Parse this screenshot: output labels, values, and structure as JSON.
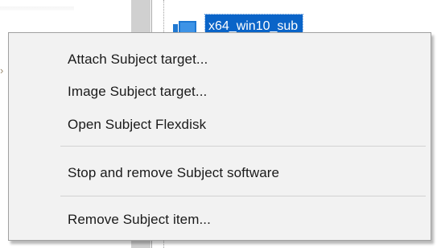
{
  "background": {
    "tree_node": {
      "label": "x64_win10_sub"
    }
  },
  "context_menu": {
    "items": [
      {
        "label": "Attach Subject target..."
      },
      {
        "label": "Image Subject target..."
      },
      {
        "label": "Open Subject Flexdisk"
      },
      {
        "label": "Stop and remove Subject software"
      },
      {
        "label": "Remove Subject item..."
      }
    ]
  },
  "colors": {
    "selection": "#0a64c8",
    "menu_background": "#f2f2f2",
    "menu_border": "#a0a0a0",
    "separator": "#d2d2d2"
  }
}
